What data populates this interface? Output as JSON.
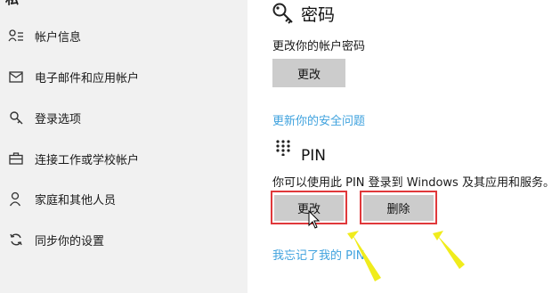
{
  "sidebar": {
    "cut_title": "私",
    "items": [
      {
        "label": "帐户信息",
        "icon": "account-info-icon"
      },
      {
        "label": "电子邮件和应用帐户",
        "icon": "mail-icon"
      },
      {
        "label": "登录选项",
        "icon": "key-icon"
      },
      {
        "label": "连接工作或学校帐户",
        "icon": "briefcase-icon"
      },
      {
        "label": "家庭和其他人员",
        "icon": "person-add-icon"
      },
      {
        "label": "同步你的设置",
        "icon": "sync-icon"
      }
    ]
  },
  "password": {
    "title": "密码",
    "icon": "key-icon",
    "description": "更改你的帐户密码",
    "change_label": "更改"
  },
  "security_link": "更新你的安全问题",
  "pin": {
    "title": "PIN",
    "icon": "keypad-icon",
    "description": "你可以使用此 PIN 登录到 Windows 及其应用和服务。",
    "change_label": "更改",
    "delete_label": "删除",
    "forgot_label": "我忘记了我的 PIN"
  },
  "colors": {
    "sidebar_bg": "#f1f1f1",
    "button_bg": "#cccccc",
    "link": "#3fa2de",
    "highlight": "#e0383b",
    "arrow": "#f0ec1c"
  }
}
